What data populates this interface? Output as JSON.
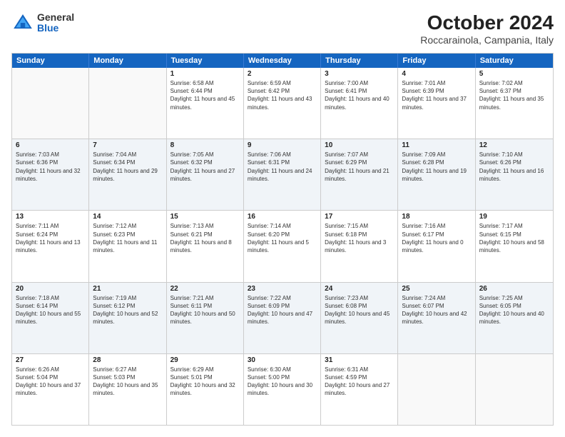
{
  "header": {
    "logo": {
      "general": "General",
      "blue": "Blue"
    },
    "title": "October 2024",
    "location": "Roccarainola, Campania, Italy"
  },
  "dayHeaders": [
    "Sunday",
    "Monday",
    "Tuesday",
    "Wednesday",
    "Thursday",
    "Friday",
    "Saturday"
  ],
  "weeks": [
    {
      "alt": false,
      "days": [
        {
          "number": "",
          "info": "",
          "empty": true
        },
        {
          "number": "",
          "info": "",
          "empty": true
        },
        {
          "number": "1",
          "info": "Sunrise: 6:58 AM\nSunset: 6:44 PM\nDaylight: 11 hours and 45 minutes.",
          "empty": false
        },
        {
          "number": "2",
          "info": "Sunrise: 6:59 AM\nSunset: 6:42 PM\nDaylight: 11 hours and 43 minutes.",
          "empty": false
        },
        {
          "number": "3",
          "info": "Sunrise: 7:00 AM\nSunset: 6:41 PM\nDaylight: 11 hours and 40 minutes.",
          "empty": false
        },
        {
          "number": "4",
          "info": "Sunrise: 7:01 AM\nSunset: 6:39 PM\nDaylight: 11 hours and 37 minutes.",
          "empty": false
        },
        {
          "number": "5",
          "info": "Sunrise: 7:02 AM\nSunset: 6:37 PM\nDaylight: 11 hours and 35 minutes.",
          "empty": false
        }
      ]
    },
    {
      "alt": true,
      "days": [
        {
          "number": "6",
          "info": "Sunrise: 7:03 AM\nSunset: 6:36 PM\nDaylight: 11 hours and 32 minutes.",
          "empty": false
        },
        {
          "number": "7",
          "info": "Sunrise: 7:04 AM\nSunset: 6:34 PM\nDaylight: 11 hours and 29 minutes.",
          "empty": false
        },
        {
          "number": "8",
          "info": "Sunrise: 7:05 AM\nSunset: 6:32 PM\nDaylight: 11 hours and 27 minutes.",
          "empty": false
        },
        {
          "number": "9",
          "info": "Sunrise: 7:06 AM\nSunset: 6:31 PM\nDaylight: 11 hours and 24 minutes.",
          "empty": false
        },
        {
          "number": "10",
          "info": "Sunrise: 7:07 AM\nSunset: 6:29 PM\nDaylight: 11 hours and 21 minutes.",
          "empty": false
        },
        {
          "number": "11",
          "info": "Sunrise: 7:09 AM\nSunset: 6:28 PM\nDaylight: 11 hours and 19 minutes.",
          "empty": false
        },
        {
          "number": "12",
          "info": "Sunrise: 7:10 AM\nSunset: 6:26 PM\nDaylight: 11 hours and 16 minutes.",
          "empty": false
        }
      ]
    },
    {
      "alt": false,
      "days": [
        {
          "number": "13",
          "info": "Sunrise: 7:11 AM\nSunset: 6:24 PM\nDaylight: 11 hours and 13 minutes.",
          "empty": false
        },
        {
          "number": "14",
          "info": "Sunrise: 7:12 AM\nSunset: 6:23 PM\nDaylight: 11 hours and 11 minutes.",
          "empty": false
        },
        {
          "number": "15",
          "info": "Sunrise: 7:13 AM\nSunset: 6:21 PM\nDaylight: 11 hours and 8 minutes.",
          "empty": false
        },
        {
          "number": "16",
          "info": "Sunrise: 7:14 AM\nSunset: 6:20 PM\nDaylight: 11 hours and 5 minutes.",
          "empty": false
        },
        {
          "number": "17",
          "info": "Sunrise: 7:15 AM\nSunset: 6:18 PM\nDaylight: 11 hours and 3 minutes.",
          "empty": false
        },
        {
          "number": "18",
          "info": "Sunrise: 7:16 AM\nSunset: 6:17 PM\nDaylight: 11 hours and 0 minutes.",
          "empty": false
        },
        {
          "number": "19",
          "info": "Sunrise: 7:17 AM\nSunset: 6:15 PM\nDaylight: 10 hours and 58 minutes.",
          "empty": false
        }
      ]
    },
    {
      "alt": true,
      "days": [
        {
          "number": "20",
          "info": "Sunrise: 7:18 AM\nSunset: 6:14 PM\nDaylight: 10 hours and 55 minutes.",
          "empty": false
        },
        {
          "number": "21",
          "info": "Sunrise: 7:19 AM\nSunset: 6:12 PM\nDaylight: 10 hours and 52 minutes.",
          "empty": false
        },
        {
          "number": "22",
          "info": "Sunrise: 7:21 AM\nSunset: 6:11 PM\nDaylight: 10 hours and 50 minutes.",
          "empty": false
        },
        {
          "number": "23",
          "info": "Sunrise: 7:22 AM\nSunset: 6:09 PM\nDaylight: 10 hours and 47 minutes.",
          "empty": false
        },
        {
          "number": "24",
          "info": "Sunrise: 7:23 AM\nSunset: 6:08 PM\nDaylight: 10 hours and 45 minutes.",
          "empty": false
        },
        {
          "number": "25",
          "info": "Sunrise: 7:24 AM\nSunset: 6:07 PM\nDaylight: 10 hours and 42 minutes.",
          "empty": false
        },
        {
          "number": "26",
          "info": "Sunrise: 7:25 AM\nSunset: 6:05 PM\nDaylight: 10 hours and 40 minutes.",
          "empty": false
        }
      ]
    },
    {
      "alt": false,
      "days": [
        {
          "number": "27",
          "info": "Sunrise: 6:26 AM\nSunset: 5:04 PM\nDaylight: 10 hours and 37 minutes.",
          "empty": false
        },
        {
          "number": "28",
          "info": "Sunrise: 6:27 AM\nSunset: 5:03 PM\nDaylight: 10 hours and 35 minutes.",
          "empty": false
        },
        {
          "number": "29",
          "info": "Sunrise: 6:29 AM\nSunset: 5:01 PM\nDaylight: 10 hours and 32 minutes.",
          "empty": false
        },
        {
          "number": "30",
          "info": "Sunrise: 6:30 AM\nSunset: 5:00 PM\nDaylight: 10 hours and 30 minutes.",
          "empty": false
        },
        {
          "number": "31",
          "info": "Sunrise: 6:31 AM\nSunset: 4:59 PM\nDaylight: 10 hours and 27 minutes.",
          "empty": false
        },
        {
          "number": "",
          "info": "",
          "empty": true
        },
        {
          "number": "",
          "info": "",
          "empty": true
        }
      ]
    }
  ]
}
